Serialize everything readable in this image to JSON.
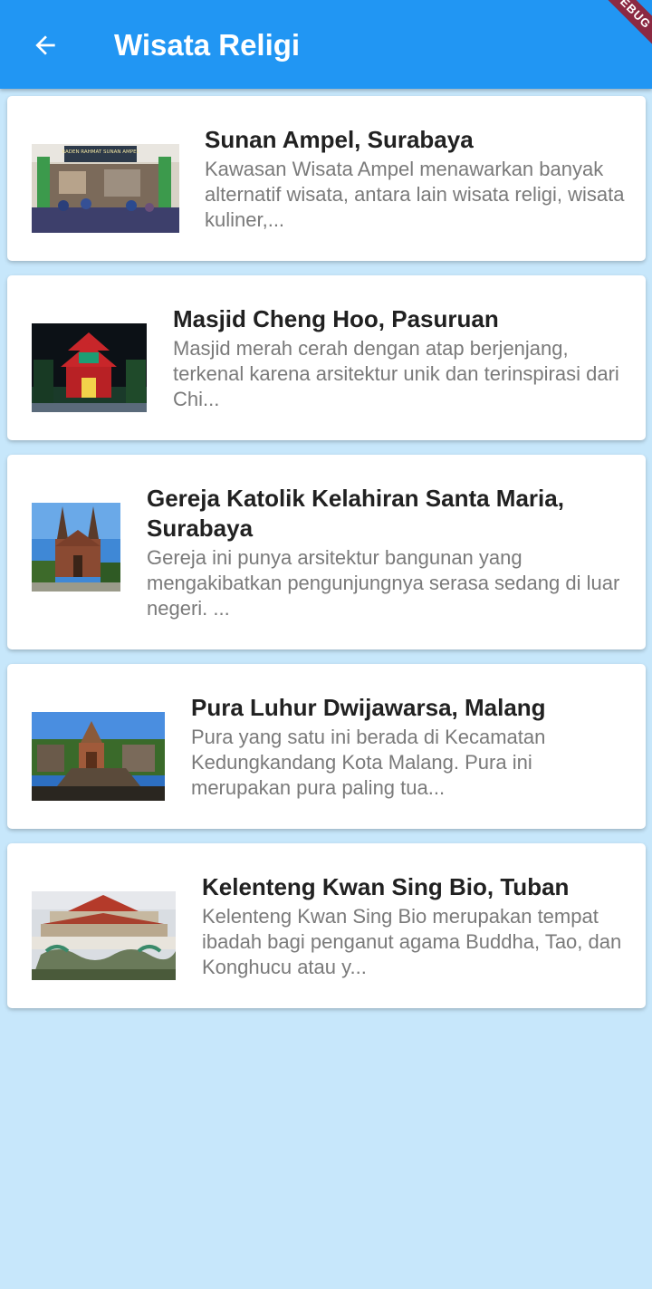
{
  "appbar": {
    "title": "Wisata Religi",
    "back_icon": "arrow-back-icon",
    "background": "#2196f3",
    "debug_banner": "DEBUG"
  },
  "places": [
    {
      "title": "Sunan Ampel, Surabaya",
      "description": "Kawasan Wisata Ampel menawarkan banyak alternatif wisata, antara lain wisata religi, wisata kuliner,...",
      "image_label": "RADEN RAHMAT SUNAN AMPEL"
    },
    {
      "title": "Masjid Cheng Hoo, Pasuruan",
      "description": "Masjid merah cerah dengan atap berjenjang, terkenal karena arsitektur unik dan terinspirasi dari Chi..."
    },
    {
      "title": "Gereja Katolik Kelahiran Santa Maria, Surabaya",
      "description": "Gereja ini punya arsitektur bangunan yang mengakibatkan pengunjungnya serasa sedang di luar negeri. ..."
    },
    {
      "title": "Pura Luhur Dwijawarsa, Malang",
      "description": "Pura yang satu ini berada di Kecamatan Kedungkandang Kota Malang. Pura ini merupakan pura paling tua..."
    },
    {
      "title": "Kelenteng Kwan Sing Bio, Tuban",
      "description": "Kelenteng Kwan Sing Bio merupakan tempat ibadah bagi penganut agama Buddha, Tao, dan Konghucu atau y..."
    }
  ]
}
